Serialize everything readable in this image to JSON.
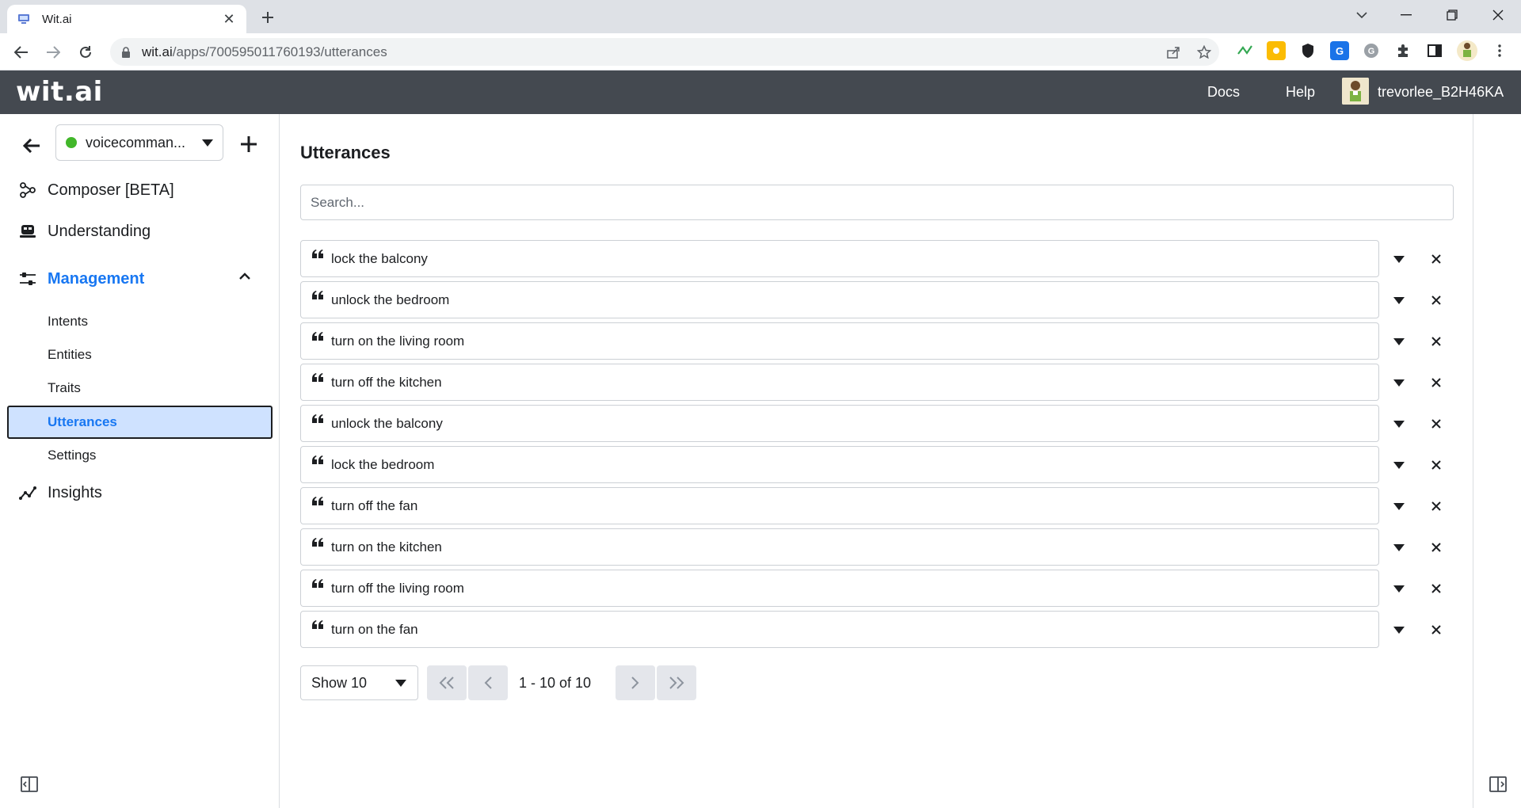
{
  "browser": {
    "tab_title": "Wit.ai",
    "url_host": "wit.ai",
    "url_path": "/apps/700595011760193/utterances"
  },
  "header": {
    "logo": "wit.ai",
    "docs_label": "Docs",
    "help_label": "Help",
    "username": "trevorlee_B2H46KA"
  },
  "sidebar": {
    "app_name": "voicecomman...",
    "app_status_color": "#42b72a",
    "nav": {
      "composer": "Composer [BETA]",
      "understanding": "Understanding",
      "management": "Management",
      "insights": "Insights"
    },
    "management_items": {
      "intents": "Intents",
      "entities": "Entities",
      "traits": "Traits",
      "utterances": "Utterances",
      "settings": "Settings"
    }
  },
  "main": {
    "title": "Utterances",
    "search_placeholder": "Search...",
    "utterances": [
      "lock the balcony",
      "unlock the bedroom",
      "turn on the living room",
      "turn off the kitchen",
      "unlock the balcony",
      "lock the bedroom",
      "turn off the fan",
      "turn on the kitchen",
      "turn off the living room",
      "turn on the fan"
    ],
    "pagination": {
      "show_label": "Show 10",
      "range_label": "1 - 10 of 10"
    }
  },
  "colors": {
    "accent": "#1877f2",
    "header_bg": "#444950",
    "selected_bg": "#cfe2ff"
  }
}
